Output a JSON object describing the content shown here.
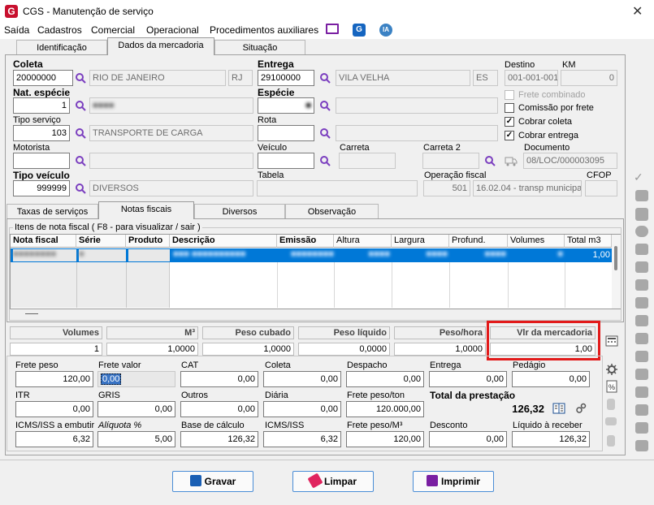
{
  "window": {
    "title": "CGS - Manutenção de serviço",
    "close": "✕"
  },
  "menu": {
    "items": [
      "Saída",
      "Cadastros",
      "Comercial",
      "Operacional",
      "Procedimentos auxiliares"
    ],
    "icons": [
      {
        "name": "monitor-icon",
        "color": "#7a1fa2"
      },
      {
        "name": "g-app-icon",
        "color": "#1565c0",
        "glyph": "G"
      },
      {
        "name": "ia-icon",
        "color": "#3b82c4",
        "glyph": "IA"
      }
    ]
  },
  "tabs": {
    "top": [
      "Identificação",
      "Dados da mercadoria",
      "Situação"
    ],
    "active": "Dados da mercadoria"
  },
  "form": {
    "coleta": {
      "label": "Coleta",
      "value": "20000000",
      "city": "RIO DE JANEIRO",
      "uf": "RJ"
    },
    "entrega": {
      "label": "Entrega",
      "value": "29100000",
      "city": "VILA VELHA",
      "uf": "ES"
    },
    "destino": {
      "label": "Destino",
      "value": "001-001-001"
    },
    "km": {
      "label": "KM",
      "value": "0"
    },
    "nat_especie": {
      "label": "Nat. espécie",
      "value": "1",
      "desc": "■■■■"
    },
    "especie": {
      "label": "Espécie",
      "value": "■",
      "desc": ""
    },
    "tipo_servico": {
      "label": "Tipo serviço",
      "value": "103",
      "desc": "TRANSPORTE DE CARGA"
    },
    "rota": {
      "label": "Rota",
      "value": "",
      "desc": ""
    },
    "motorista": {
      "label": "Motorista",
      "value": "",
      "desc": ""
    },
    "veiculo": {
      "label": "Veículo",
      "value": ""
    },
    "carreta": {
      "label": "Carreta",
      "value": ""
    },
    "carreta2": {
      "label": "Carreta 2",
      "value": ""
    },
    "documento": {
      "label": "Documento",
      "value": "08/LOC/000003095"
    },
    "tipo_veiculo": {
      "label": "Tipo veículo",
      "value": "999999",
      "desc": "DIVERSOS"
    },
    "tabela": {
      "label": "Tabela",
      "value": ""
    },
    "operacao_fiscal": {
      "label": "Operação fiscal",
      "code": "501",
      "desc": "16.02.04 - transp municipal"
    },
    "cfop": {
      "label": "CFOP",
      "value": ""
    },
    "checks": [
      {
        "label": "Frete combinado",
        "checked": false,
        "disabled": true
      },
      {
        "label": "Comissão por frete",
        "checked": false,
        "disabled": false
      },
      {
        "label": "Cobrar coleta",
        "checked": true,
        "disabled": false
      },
      {
        "label": "Cobrar entrega",
        "checked": true,
        "disabled": false
      }
    ],
    "check_mark": "✓"
  },
  "subtabs": {
    "items": [
      "Taxas de serviços",
      "Notas fiscais",
      "Diversos",
      "Observação"
    ],
    "active": "Notas fiscais"
  },
  "nf": {
    "group_title": "Itens de nota fiscal ( F8 - para visualizar / sair )",
    "columns": [
      "Nota fiscal",
      "Série",
      "Produto",
      "Descrição",
      "Emissão",
      "Altura",
      "Largura",
      "Profund.",
      "Volumes",
      "Total m3"
    ],
    "row": {
      "nota": "■■■■■■■■",
      "serie": "■",
      "produto": "",
      "descricao": "■■■ ■■■■■■■■■■",
      "emissao": "■■■■■■■■",
      "altura": "■■■■",
      "largura": "■■■■",
      "profund": "■■■■",
      "volumes": "■",
      "total_m3": "1,00"
    }
  },
  "totals": {
    "headers": [
      "Volumes",
      "M³",
      "Peso cubado",
      "Peso líquido",
      "Peso/hora",
      "Vlr da mercadoria"
    ],
    "values": [
      "1",
      "1,0000",
      "1,0000",
      "0,0000",
      "1,0000",
      "1,00"
    ]
  },
  "freight": {
    "row1": [
      {
        "label": "Frete peso",
        "value": "120,00"
      },
      {
        "label": "Frete valor",
        "value": "0,00"
      },
      {
        "label": "CAT",
        "value": "0,00"
      },
      {
        "label": "Coleta",
        "value": "0,00"
      },
      {
        "label": "Despacho",
        "value": "0,00"
      },
      {
        "label": "Entrega",
        "value": "0,00"
      },
      {
        "label": "Pedágio",
        "value": "0,00"
      }
    ],
    "row2": [
      {
        "label": "ITR",
        "value": "0,00"
      },
      {
        "label": "GRIS",
        "value": "0,00"
      },
      {
        "label": "Outros",
        "value": "0,00"
      },
      {
        "label": "Diária",
        "value": "0,00"
      },
      {
        "label": "Frete peso/ton",
        "value": "120.000,00"
      }
    ],
    "total": {
      "label": "Total da prestação",
      "value": "126,32"
    },
    "row3": [
      {
        "label": "ICMS/ISS a embutir",
        "value": "6,32"
      },
      {
        "label": "Alíquota %",
        "value": "5,00"
      },
      {
        "label": "Base de cálculo",
        "value": "126,32"
      },
      {
        "label": "ICMS/ISS",
        "value": "6,32"
      },
      {
        "label": "Frete peso/M³",
        "value": "120,00"
      },
      {
        "label": "Desconto",
        "value": "0,00"
      },
      {
        "label": "Líquido à receber",
        "value": "126,32"
      }
    ]
  },
  "buttons": {
    "save": "Gravar",
    "clear": "Limpar",
    "print": "Imprimir"
  },
  "side_toolbar": {
    "check": "✓"
  },
  "colors": {
    "selection": "#0078d7",
    "highlight_box": "#e21a1a",
    "lupa": "#7b3fbf",
    "button_border": "#4a8dd6"
  }
}
